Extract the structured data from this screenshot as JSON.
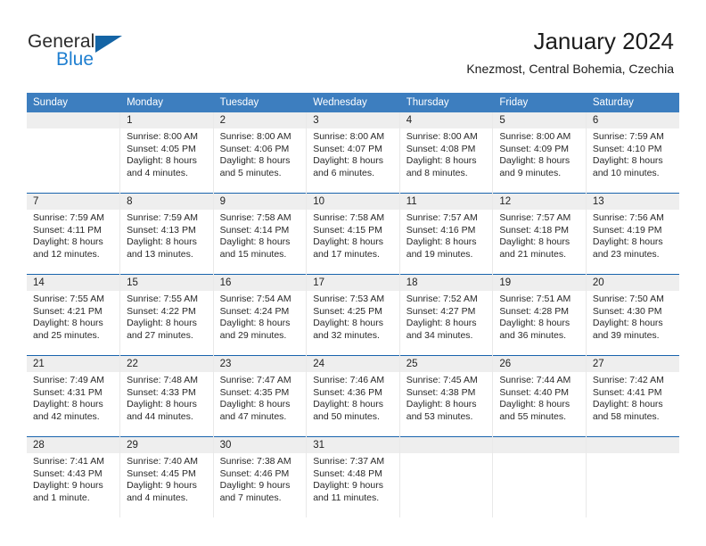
{
  "brand": {
    "name_part1": "General",
    "name_part2": "Blue",
    "triangle_icon": "triangle-icon",
    "color_dark": "#2b2b2b",
    "color_blue": "#1f7fd0"
  },
  "header": {
    "title": "January 2024",
    "subtitle": "Knezmost, Central Bohemia, Czechia"
  },
  "theme": {
    "header_blue": "#3d7ebf",
    "row_divider_blue": "#1964ad",
    "day_band_gray": "#eeeeee"
  },
  "weekdays": [
    "Sunday",
    "Monday",
    "Tuesday",
    "Wednesday",
    "Thursday",
    "Friday",
    "Saturday"
  ],
  "weeks": [
    [
      {
        "day": ""
      },
      {
        "day": "1",
        "sunrise": "Sunrise: 8:00 AM",
        "sunset": "Sunset: 4:05 PM",
        "daylight": "Daylight: 8 hours and 4 minutes."
      },
      {
        "day": "2",
        "sunrise": "Sunrise: 8:00 AM",
        "sunset": "Sunset: 4:06 PM",
        "daylight": "Daylight: 8 hours and 5 minutes."
      },
      {
        "day": "3",
        "sunrise": "Sunrise: 8:00 AM",
        "sunset": "Sunset: 4:07 PM",
        "daylight": "Daylight: 8 hours and 6 minutes."
      },
      {
        "day": "4",
        "sunrise": "Sunrise: 8:00 AM",
        "sunset": "Sunset: 4:08 PM",
        "daylight": "Daylight: 8 hours and 8 minutes."
      },
      {
        "day": "5",
        "sunrise": "Sunrise: 8:00 AM",
        "sunset": "Sunset: 4:09 PM",
        "daylight": "Daylight: 8 hours and 9 minutes."
      },
      {
        "day": "6",
        "sunrise": "Sunrise: 7:59 AM",
        "sunset": "Sunset: 4:10 PM",
        "daylight": "Daylight: 8 hours and 10 minutes."
      }
    ],
    [
      {
        "day": "7",
        "sunrise": "Sunrise: 7:59 AM",
        "sunset": "Sunset: 4:11 PM",
        "daylight": "Daylight: 8 hours and 12 minutes."
      },
      {
        "day": "8",
        "sunrise": "Sunrise: 7:59 AM",
        "sunset": "Sunset: 4:13 PM",
        "daylight": "Daylight: 8 hours and 13 minutes."
      },
      {
        "day": "9",
        "sunrise": "Sunrise: 7:58 AM",
        "sunset": "Sunset: 4:14 PM",
        "daylight": "Daylight: 8 hours and 15 minutes."
      },
      {
        "day": "10",
        "sunrise": "Sunrise: 7:58 AM",
        "sunset": "Sunset: 4:15 PM",
        "daylight": "Daylight: 8 hours and 17 minutes."
      },
      {
        "day": "11",
        "sunrise": "Sunrise: 7:57 AM",
        "sunset": "Sunset: 4:16 PM",
        "daylight": "Daylight: 8 hours and 19 minutes."
      },
      {
        "day": "12",
        "sunrise": "Sunrise: 7:57 AM",
        "sunset": "Sunset: 4:18 PM",
        "daylight": "Daylight: 8 hours and 21 minutes."
      },
      {
        "day": "13",
        "sunrise": "Sunrise: 7:56 AM",
        "sunset": "Sunset: 4:19 PM",
        "daylight": "Daylight: 8 hours and 23 minutes."
      }
    ],
    [
      {
        "day": "14",
        "sunrise": "Sunrise: 7:55 AM",
        "sunset": "Sunset: 4:21 PM",
        "daylight": "Daylight: 8 hours and 25 minutes."
      },
      {
        "day": "15",
        "sunrise": "Sunrise: 7:55 AM",
        "sunset": "Sunset: 4:22 PM",
        "daylight": "Daylight: 8 hours and 27 minutes."
      },
      {
        "day": "16",
        "sunrise": "Sunrise: 7:54 AM",
        "sunset": "Sunset: 4:24 PM",
        "daylight": "Daylight: 8 hours and 29 minutes."
      },
      {
        "day": "17",
        "sunrise": "Sunrise: 7:53 AM",
        "sunset": "Sunset: 4:25 PM",
        "daylight": "Daylight: 8 hours and 32 minutes."
      },
      {
        "day": "18",
        "sunrise": "Sunrise: 7:52 AM",
        "sunset": "Sunset: 4:27 PM",
        "daylight": "Daylight: 8 hours and 34 minutes."
      },
      {
        "day": "19",
        "sunrise": "Sunrise: 7:51 AM",
        "sunset": "Sunset: 4:28 PM",
        "daylight": "Daylight: 8 hours and 36 minutes."
      },
      {
        "day": "20",
        "sunrise": "Sunrise: 7:50 AM",
        "sunset": "Sunset: 4:30 PM",
        "daylight": "Daylight: 8 hours and 39 minutes."
      }
    ],
    [
      {
        "day": "21",
        "sunrise": "Sunrise: 7:49 AM",
        "sunset": "Sunset: 4:31 PM",
        "daylight": "Daylight: 8 hours and 42 minutes."
      },
      {
        "day": "22",
        "sunrise": "Sunrise: 7:48 AM",
        "sunset": "Sunset: 4:33 PM",
        "daylight": "Daylight: 8 hours and 44 minutes."
      },
      {
        "day": "23",
        "sunrise": "Sunrise: 7:47 AM",
        "sunset": "Sunset: 4:35 PM",
        "daylight": "Daylight: 8 hours and 47 minutes."
      },
      {
        "day": "24",
        "sunrise": "Sunrise: 7:46 AM",
        "sunset": "Sunset: 4:36 PM",
        "daylight": "Daylight: 8 hours and 50 minutes."
      },
      {
        "day": "25",
        "sunrise": "Sunrise: 7:45 AM",
        "sunset": "Sunset: 4:38 PM",
        "daylight": "Daylight: 8 hours and 53 minutes."
      },
      {
        "day": "26",
        "sunrise": "Sunrise: 7:44 AM",
        "sunset": "Sunset: 4:40 PM",
        "daylight": "Daylight: 8 hours and 55 minutes."
      },
      {
        "day": "27",
        "sunrise": "Sunrise: 7:42 AM",
        "sunset": "Sunset: 4:41 PM",
        "daylight": "Daylight: 8 hours and 58 minutes."
      }
    ],
    [
      {
        "day": "28",
        "sunrise": "Sunrise: 7:41 AM",
        "sunset": "Sunset: 4:43 PM",
        "daylight": "Daylight: 9 hours and 1 minute."
      },
      {
        "day": "29",
        "sunrise": "Sunrise: 7:40 AM",
        "sunset": "Sunset: 4:45 PM",
        "daylight": "Daylight: 9 hours and 4 minutes."
      },
      {
        "day": "30",
        "sunrise": "Sunrise: 7:38 AM",
        "sunset": "Sunset: 4:46 PM",
        "daylight": "Daylight: 9 hours and 7 minutes."
      },
      {
        "day": "31",
        "sunrise": "Sunrise: 7:37 AM",
        "sunset": "Sunset: 4:48 PM",
        "daylight": "Daylight: 9 hours and 11 minutes."
      },
      {
        "day": ""
      },
      {
        "day": ""
      },
      {
        "day": ""
      }
    ]
  ]
}
